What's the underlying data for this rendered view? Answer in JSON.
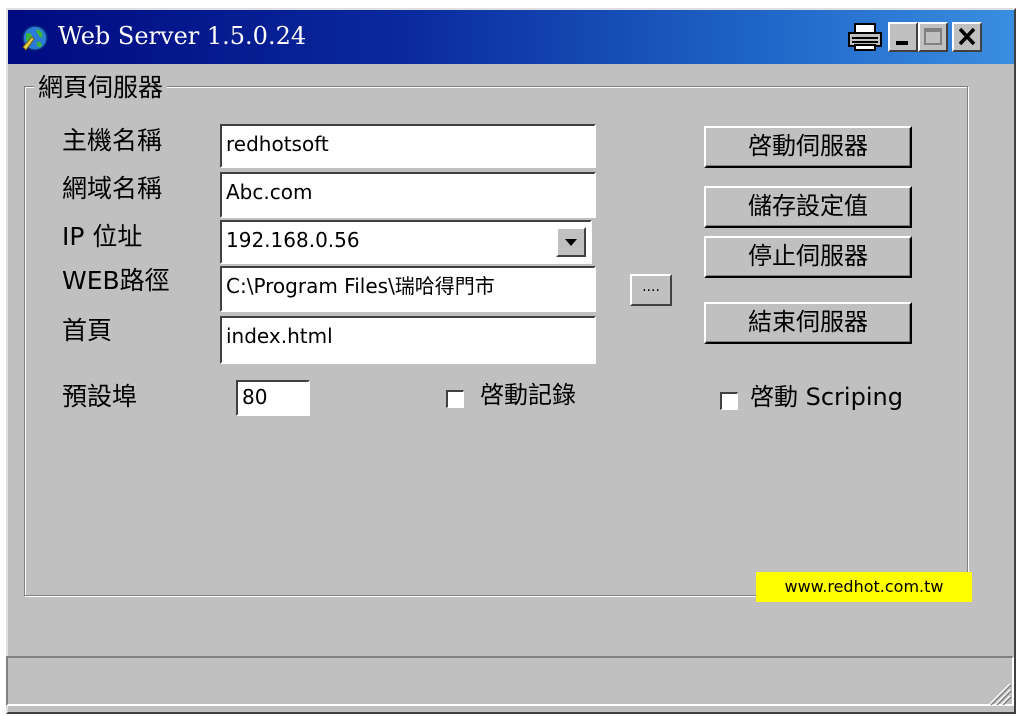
{
  "window": {
    "title": "Web Server 1.5.0.24"
  },
  "group": {
    "title": "網頁伺服器"
  },
  "fields": {
    "host_label": "主機名稱",
    "host_value": "redhotsoft",
    "domain_label": "網域名稱",
    "domain_value": "Abc.com",
    "ip_label": "IP 位址",
    "ip_value": "192.168.0.56",
    "webpath_label": "WEB路徑",
    "webpath_value": "C:\\Program Files\\瑞哈得門市",
    "homepage_label": "首頁",
    "homepage_value": "index.html",
    "port_label": "預設埠",
    "port_value": "80"
  },
  "buttons": {
    "start": "啓動伺服器",
    "save": "儲存設定值",
    "stop": "停止伺服器",
    "exit": "結束伺服器",
    "browse": "...."
  },
  "checkboxes": {
    "log_label": "啓動記錄",
    "log_checked": false,
    "scripting_label": "啓動 Scriping",
    "scripting_checked": false
  },
  "footer": {
    "link": "www.redhot.com.tw"
  },
  "colors": {
    "titlebar_start": "#000a80",
    "titlebar_end": "#3a8ee0",
    "face": "#c0c0c0",
    "link_bg": "#ffff00"
  }
}
